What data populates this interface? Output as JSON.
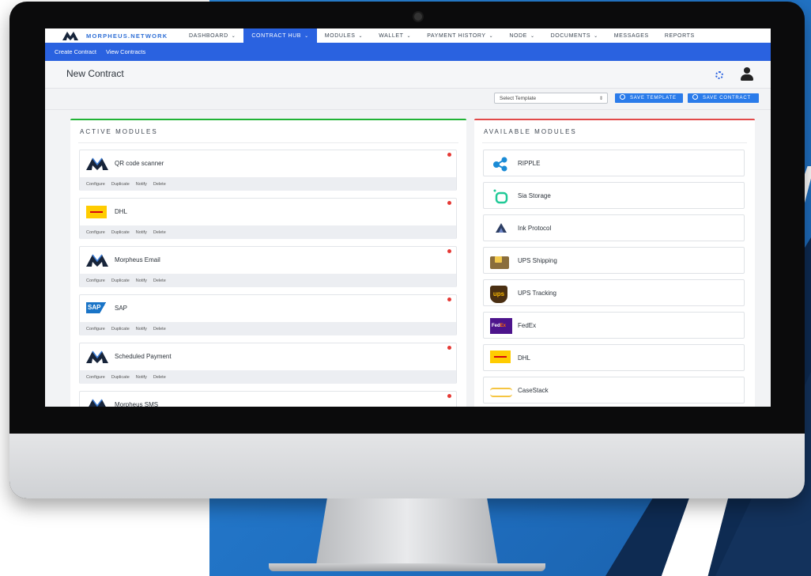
{
  "nav": {
    "brand": "MORPHEUS.NETWORK",
    "items": [
      {
        "label": "DASHBOARD",
        "dropdown": true,
        "active": false
      },
      {
        "label": "CONTRACT HUB",
        "dropdown": true,
        "active": true
      },
      {
        "label": "MODULES",
        "dropdown": true,
        "active": false
      },
      {
        "label": "WALLET",
        "dropdown": true,
        "active": false
      },
      {
        "label": "PAYMENT HISTORY",
        "dropdown": true,
        "active": false
      },
      {
        "label": "NODE",
        "dropdown": true,
        "active": false
      },
      {
        "label": "DOCUMENTS",
        "dropdown": true,
        "active": false
      },
      {
        "label": "MESSAGES",
        "dropdown": false,
        "active": false
      },
      {
        "label": "REPORTS",
        "dropdown": false,
        "active": false
      }
    ]
  },
  "subnav": {
    "create": "Create Contract",
    "view": "View Contracts"
  },
  "page": {
    "title": "New Contract"
  },
  "toolbar": {
    "select_value": "Select Template",
    "save_template": "SAVE TEMPLATE",
    "save_contract": "SAVE CONTRACT"
  },
  "active": {
    "title": "ACTIVE MODULES",
    "actions": {
      "configure": "Configure",
      "duplicate": "Duplicate",
      "notify": "Notify",
      "delete": "Delete"
    },
    "modules": [
      {
        "name": "QR code scanner",
        "logo": "morpheus-logo"
      },
      {
        "name": "DHL",
        "logo": "dhl-logo"
      },
      {
        "name": "Morpheus Email",
        "logo": "morpheus-logo"
      },
      {
        "name": "SAP",
        "logo": "sap-logo"
      },
      {
        "name": "Scheduled Payment",
        "logo": "morpheus-logo"
      },
      {
        "name": "Morpheus SMS",
        "logo": "morpheus-logo"
      }
    ]
  },
  "available": {
    "title": "AVAILABLE MODULES",
    "modules": [
      {
        "name": "RIPPLE",
        "logo": "ripple-logo"
      },
      {
        "name": "Sia Storage",
        "logo": "sia-logo"
      },
      {
        "name": "Ink Protocol",
        "logo": "ink-logo"
      },
      {
        "name": "UPS Shipping",
        "logo": "ups-shipping-logo"
      },
      {
        "name": "UPS Tracking",
        "logo": "ups-logo"
      },
      {
        "name": "FedEx",
        "logo": "fedex-logo"
      },
      {
        "name": "DHL",
        "logo": "dhl-logo"
      },
      {
        "name": "CaseStack",
        "logo": "casestack-logo"
      }
    ]
  },
  "colors": {
    "primary": "#2a62e0",
    "active_border": "#21b336",
    "available_border": "#e24a4a",
    "status_dot": "#e53935"
  }
}
